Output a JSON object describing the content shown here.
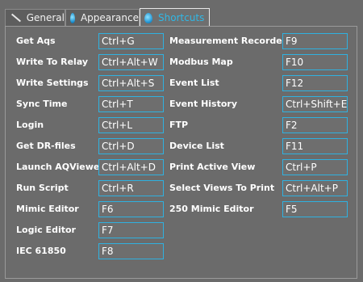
{
  "tabs": [
    {
      "label": "General",
      "icon": "pen-icon",
      "active": false
    },
    {
      "label": "Appearance",
      "icon": "droplet-icon",
      "active": false
    },
    {
      "label": "Shortcuts",
      "icon": "droplet-icon",
      "active": true
    }
  ],
  "shortcuts_left": [
    {
      "label": "Get Aqs",
      "key": "Ctrl+G"
    },
    {
      "label": "Write To Relay",
      "key": "Ctrl+Alt+W"
    },
    {
      "label": "Write Settings",
      "key": "Ctrl+Alt+S"
    },
    {
      "label": "Sync Time",
      "key": "Ctrl+T"
    },
    {
      "label": "Login",
      "key": "Ctrl+L"
    },
    {
      "label": "Get DR-files",
      "key": "Ctrl+D"
    },
    {
      "label": "Launch AQViewer",
      "key": "Ctrl+Alt+D"
    },
    {
      "label": "Run Script",
      "key": "Ctrl+R"
    },
    {
      "label": "Mimic Editor",
      "key": "F6"
    },
    {
      "label": "Logic Editor",
      "key": "F7"
    },
    {
      "label": "IEC 61850",
      "key": "F8"
    }
  ],
  "shortcuts_right": [
    {
      "label": "Measurement Recorder",
      "key": "F9"
    },
    {
      "label": "Modbus Map",
      "key": "F10"
    },
    {
      "label": "Event List",
      "key": "F12"
    },
    {
      "label": "Event History",
      "key": "Ctrl+Shift+E"
    },
    {
      "label": "FTP",
      "key": "F2"
    },
    {
      "label": "Device List",
      "key": "F11"
    },
    {
      "label": "Print Active View",
      "key": "Ctrl+P"
    },
    {
      "label": "Select Views To Print",
      "key": "Ctrl+Alt+P"
    },
    {
      "label": "250 Mimic Editor",
      "key": "F5"
    }
  ]
}
